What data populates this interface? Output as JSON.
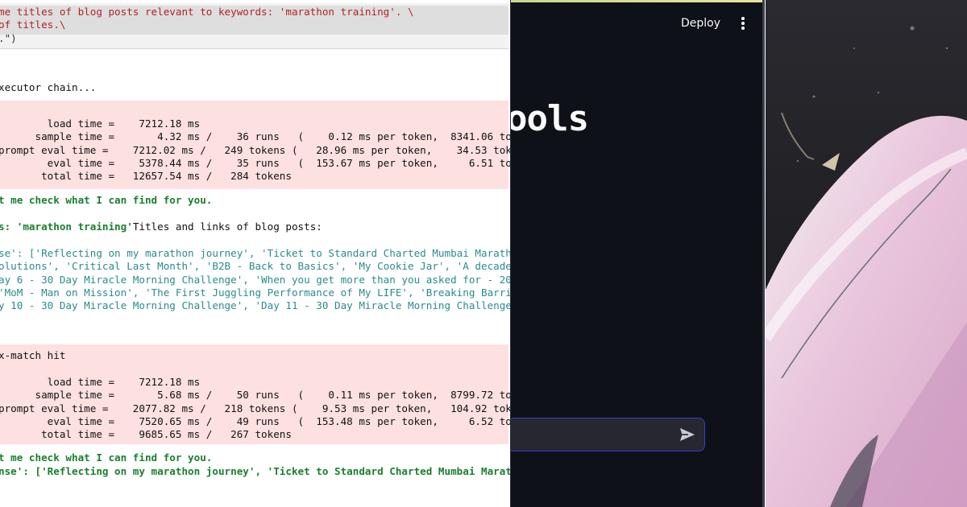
{
  "notebook": {
    "code_lines": [
      "me titles of blog posts relevant to keywords: 'marathon training'. \\",
      "of titles.\\",
      ".\")"
    ],
    "chain_line": "xecutor chain...",
    "timing1": [
      "        load time =    7212.18 ms",
      "      sample time =       4.32 ms /    36 runs   (    0.12 ms per token,  8341.06 toke",
      "prompt eval time =    7212.02 ms /   249 tokens (   28.96 ms per token,    34.53 toke",
      "        eval time =    5378.44 ms /    35 runs   (  153.67 ms per token,     6.51 toke",
      "       total time =   12657.54 ms /   284 tokens"
    ],
    "check1": "t me check what I can find for you.",
    "keywords_prefix": "s: 'marathon training'",
    "keywords_suffix": "Titles and links of blog posts:",
    "response_lines": [
      "se': ['Reflecting on my marathon journey', 'Ticket to Standard Charted Mumbai Maratho",
      "olutions', 'Critical Last Month', 'B2B - Back to Basics', 'My Cookie Jar', 'A decade",
      "ay 6 - 30 Day Miracle Morning Challenge', 'When you get more than you asked for - 202",
      "'MoM - Man on Mission', 'The First Juggling Performance of My LIFE', 'Breaking Barrie",
      "y 10 - 30 Day Miracle Morning Challenge', 'Day 11 - 30 Day Miracle Morning Challenge'"
    ],
    "match_line": "x-match hit",
    "timing2": [
      "        load time =    7212.18 ms",
      "      sample time =       5.68 ms /    50 runs   (    0.11 ms per token,  8799.72 toke",
      "prompt eval time =    2077.82 ms /   218 tokens (    9.53 ms per token,   104.92 toke",
      "        eval time =    7520.65 ms /    49 runs   (  153.48 ms per token,     6.52 toke",
      "       total time =    9685.65 ms /   267 tokens"
    ],
    "check2": "t me check what I can find for you.",
    "final_response": "nse': ['Reflecting on my marathon journey', 'Ticket to Standard Charted Mumbai Marath"
  },
  "app": {
    "deploy_label": "Deploy",
    "menu_icon": "kebab-menu-icon",
    "title_fragment": "ools",
    "send_icon": "send-arrow-icon",
    "colors": {
      "background": "#0e1117",
      "text": "#fafafa",
      "input_border": "#3a3ad0"
    }
  },
  "artwork": {
    "description_icon": "anime-illustration-crop"
  }
}
